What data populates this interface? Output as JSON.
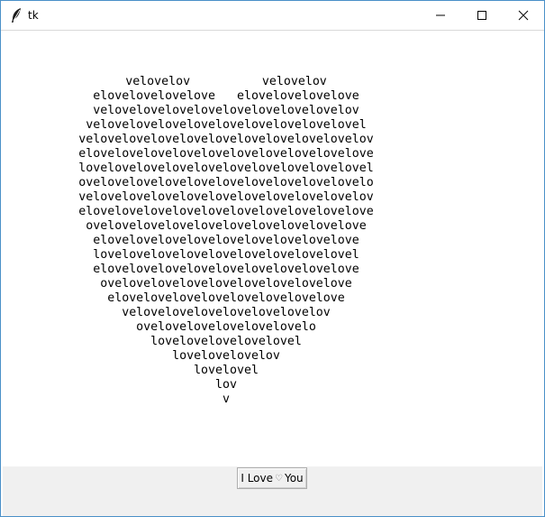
{
  "window": {
    "title": "tk",
    "icon": "feather-icon",
    "controls": [
      "minimize-icon",
      "maximize-icon",
      "close-icon"
    ]
  },
  "heart_lines": [
    "velovelov          velovelov",
    "elovelovelovelove   elovelovelovelove",
    "velovelovelovelovelovelovelovelovelov",
    "velovelovelovelovelovelovelovelovelovel",
    "velovelovelovelovelovelovelovelovelovelov",
    "elovelovelovelovelovelovelovelovelovelove",
    "lovelovelovelovelovelovelovelovelovelovel",
    "ovelovelovelovelovelovelovelovelovelovelo",
    "velovelovelovelovelovelovelovelovelovelov",
    "elovelovelovelovelovelovelovelovelovelove",
    "ovelovelovelovelovelovelovelovelovelove",
    "elovelovelovelovelovelovelovelovelove",
    "lovelovelovelovelovelovelovelovelovel",
    "elovelovelovelovelovelovelovelovelove",
    "ovelovelovelovelovelovelovelovelove",
    "elovelovelovelovelovelovelovelove",
    "velovelovelovelovelovelovelov",
    "ovelovelovelovelovelovelo",
    "lovelovelovelovelovel",
    "lovelovelovelov",
    "lovelovel",
    "lov",
    "v"
  ],
  "button": {
    "label_before": "I Love",
    "heart_symbol": "♡",
    "label_after": "You"
  }
}
